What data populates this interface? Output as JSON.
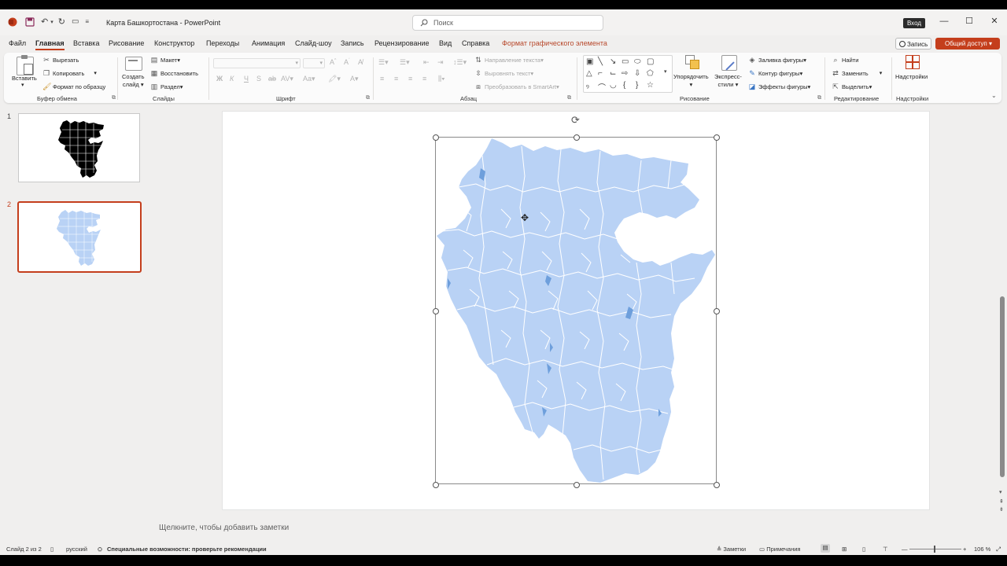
{
  "window": {
    "doc_title": "Карта Башкортостана",
    "app_name": "PowerPoint",
    "title_sep": " - ",
    "search_placeholder": "Поиск",
    "sign_in": "Вход",
    "minimize": "—",
    "restore": "☐",
    "close": "✕"
  },
  "tabs": [
    "Файл",
    "Главная",
    "Вставка",
    "Рисование",
    "Конструктор",
    "Переходы",
    "Анимация",
    "Слайд-шоу",
    "Запись",
    "Рецензирование",
    "Вид",
    "Справка",
    "Формат графического элемента"
  ],
  "active_tab": "Главная",
  "record_button": "Запись",
  "share_button": "Общий доступ",
  "ribbon": {
    "clipboard": {
      "paste": "Вставить",
      "cut": "Вырезать",
      "copy": "Копировать",
      "format_painter": "Формат по образцу",
      "label": "Буфер обмена"
    },
    "slides": {
      "new_slide_1": "Создать",
      "new_slide_2": "слайд",
      "layout": "Макет",
      "reset": "Восстановить",
      "section": "Раздел",
      "label": "Слайды"
    },
    "font": {
      "label": "Шрифт",
      "bold": "Ж",
      "italic": "К",
      "underline": "Ч",
      "shadow": "S"
    },
    "paragraph": {
      "text_direction": "Направление текста",
      "align_text": "Выровнять текст",
      "smartart": "Преобразовать в SmartArt",
      "label": "Абзац"
    },
    "drawing": {
      "arrange": "Упорядочить",
      "quick_styles_1": "Экспресс-",
      "quick_styles_2": "стили",
      "shape_fill": "Заливка фигуры",
      "shape_outline": "Контур фигуры",
      "shape_effects": "Эффекты фигуры",
      "label": "Рисование"
    },
    "editing": {
      "find": "Найти",
      "replace": "Заменить",
      "select": "Выделить",
      "label": "Редактирование"
    },
    "addins": {
      "button": "Надстройки",
      "label": "Надстройки"
    }
  },
  "slides": [
    {
      "number": "1",
      "selected": false
    },
    {
      "number": "2",
      "selected": true
    }
  ],
  "notes_placeholder": "Щелкните, чтобы добавить заметки",
  "status": {
    "slide_info": "Слайд 2 из 2",
    "language": "русский",
    "accessibility": "Специальные возможности: проверьте рекомендации",
    "notes": "Заметки",
    "comments": "Примечания",
    "zoom": "106 %"
  },
  "colors": {
    "accent": "#c43e1c",
    "map_fill": "#b9d2f5",
    "map_border": "#ffffff",
    "map_water": "#6e9fdc",
    "thumb1_fill": "#000000"
  }
}
